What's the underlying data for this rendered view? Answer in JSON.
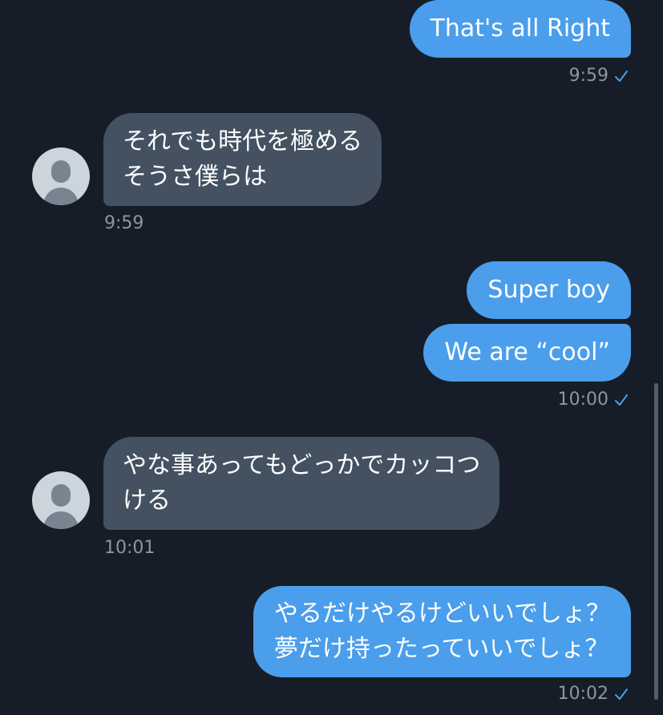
{
  "colors": {
    "background": "#161d28",
    "sent_bubble": "#4a9eeb",
    "received_bubble": "#435161",
    "timestamp": "#8a96a3",
    "read_check": "#4a9eeb"
  },
  "messages": [
    {
      "direction": "sent",
      "lines": [
        "That's all Right"
      ],
      "time": "9:59",
      "status_icon": "check-icon"
    },
    {
      "direction": "received",
      "lines": [
        "それでも時代を極める",
        "そうさ僕らは"
      ],
      "time": "9:59"
    },
    {
      "direction": "sent",
      "lines": [
        "Super boy"
      ]
    },
    {
      "direction": "sent",
      "lines": [
        "We are “cool”"
      ],
      "time": "10:00",
      "status_icon": "check-icon"
    },
    {
      "direction": "received",
      "lines": [
        "やな事あってもどっかでカッコつ",
        "ける"
      ],
      "time": "10:01"
    },
    {
      "direction": "sent",
      "lines": [
        "やるだけやるけどいいでしょ？",
        "夢だけ持ったっていいでしょ？"
      ],
      "time": "10:02",
      "status_icon": "check-icon"
    }
  ]
}
